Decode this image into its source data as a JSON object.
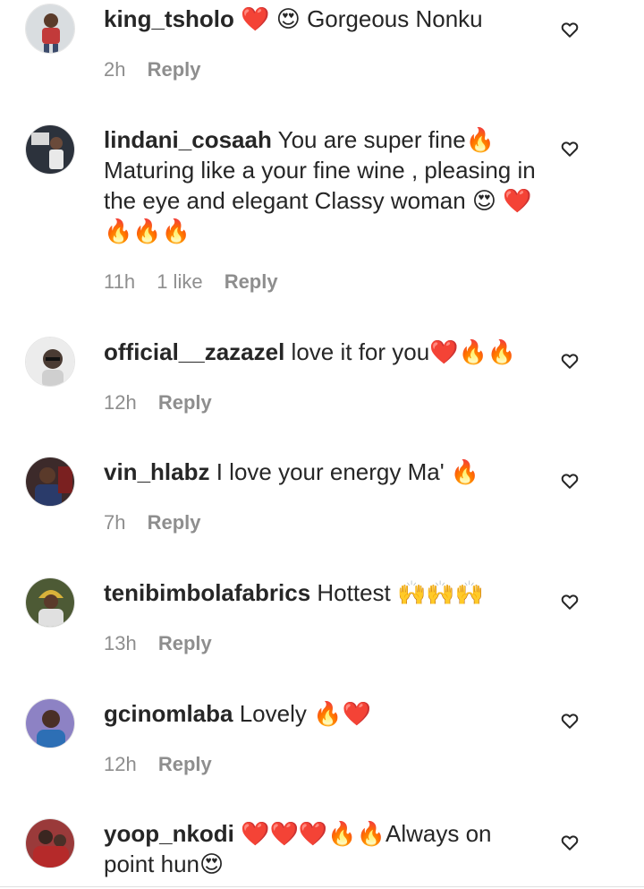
{
  "comments": [
    {
      "username": "king_tsholo",
      "text": "❤️ 😍 Gorgeous Nonku",
      "time": "2h",
      "likes": "",
      "reply_label": "Reply",
      "avatar_color": "#7a9a6a"
    },
    {
      "username": "lindani_cosaah",
      "text": "You are super fine🔥 Maturing like a your fine wine , pleasing in the eye and elegant Classy woman 😍 ❤️🔥🔥🔥",
      "time": "11h",
      "likes": "1 like",
      "reply_label": "Reply",
      "avatar_color": "#3a4250"
    },
    {
      "username": "official__zazazel",
      "text": "love it for you❤️🔥🔥",
      "time": "12h",
      "likes": "",
      "reply_label": "Reply",
      "avatar_color": "#c9c9c9"
    },
    {
      "username": "vin_hlabz",
      "text": "I love your energy Ma' 🔥",
      "time": "7h",
      "likes": "",
      "reply_label": "Reply",
      "avatar_color": "#5b3b3b"
    },
    {
      "username": "tenibimbolafabrics",
      "text": "Hottest 🙌🙌🙌",
      "time": "13h",
      "likes": "",
      "reply_label": "Reply",
      "avatar_color": "#5a6b3a"
    },
    {
      "username": "gcinomlaba",
      "text": "Lovely 🔥❤️",
      "time": "12h",
      "likes": "",
      "reply_label": "Reply",
      "avatar_color": "#7d6fb5"
    },
    {
      "username": "yoop_nkodi",
      "text": "❤️❤️❤️🔥🔥Always on point hun😍",
      "time": "",
      "likes": "",
      "reply_label": "",
      "avatar_color": "#8a2f2f"
    }
  ],
  "colors": {
    "username": "#262626",
    "meta": "#8e8e8e",
    "like_icon": "#262626"
  },
  "icons": {
    "like": "heart-outline-icon"
  }
}
